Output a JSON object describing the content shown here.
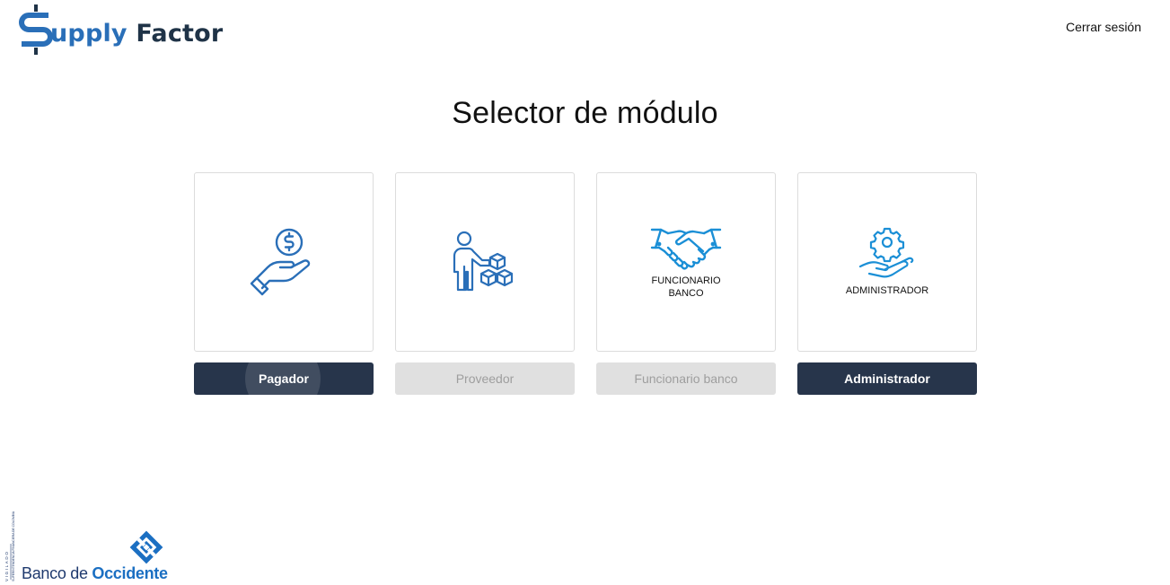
{
  "header": {
    "logo_part1": "upply",
    "logo_part2": "Factor",
    "logout_label": "Cerrar sesión"
  },
  "page_title": "Selector de módulo",
  "modules": [
    {
      "card_label": "",
      "button_label": "Pagador",
      "state": "active",
      "icon": "hand-coin-icon"
    },
    {
      "card_label": "",
      "button_label": "Proveedor",
      "state": "disabled",
      "icon": "person-boxes-icon"
    },
    {
      "card_label": "FUNCIONARIO\nBANCO",
      "button_label": "Funcionario banco",
      "state": "disabled",
      "icon": "handshake-icon"
    },
    {
      "card_label": "ADMINISTRADOR",
      "button_label": "Administrador",
      "state": "active",
      "icon": "hand-gear-icon"
    }
  ],
  "footer": {
    "vigilado_text": "VIGILADO",
    "superintendencia_text": "SUPERINTENDENCIA FINANCIERA DE COLOMBIA",
    "bank_name_part1": "Banco de ",
    "bank_name_part2": "Occidente"
  },
  "colors": {
    "primary_button": "#27354b",
    "disabled_button": "#e0e0e0",
    "icon_blue": "#2a6fb8",
    "logo_dark": "#1f3347"
  }
}
